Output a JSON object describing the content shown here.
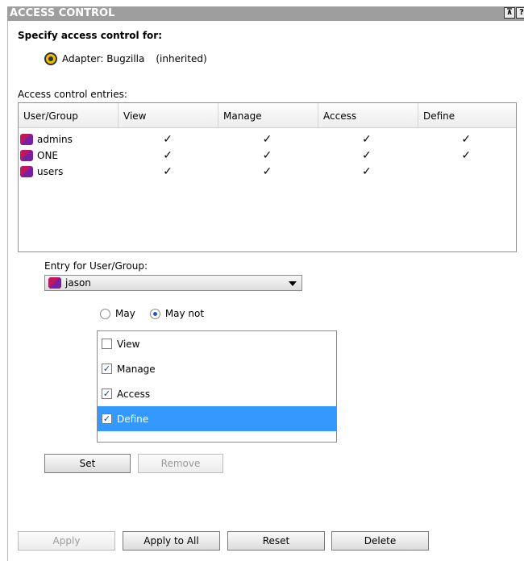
{
  "title": "ACCESS CONTROL",
  "title_buttons": [
    "⊼",
    "?"
  ],
  "heading": "Specify access control for:",
  "adapter": {
    "label": "Adapter: Bugzilla",
    "note": "(inherited)"
  },
  "entries_label": "Access control entries:",
  "columns": [
    "User/Group",
    "View",
    "Manage",
    "Access",
    "Define"
  ],
  "rows": [
    {
      "name": "admins",
      "view": "✓",
      "manage": "✓",
      "access": "✓",
      "define": "✓"
    },
    {
      "name": "ONE",
      "view": "✓",
      "manage": "✓",
      "access": "✓",
      "define": "✓"
    },
    {
      "name": "users",
      "view": "✓",
      "manage": "✓",
      "access": "✓",
      "define": ""
    }
  ],
  "entry_label": "Entry for User/Group:",
  "selected_user": "jason",
  "radio": {
    "may": "May",
    "may_not": "May not",
    "selected": "may_not"
  },
  "permissions": [
    {
      "label": "View",
      "checked": false
    },
    {
      "label": "Manage",
      "checked": true
    },
    {
      "label": "Access",
      "checked": true
    },
    {
      "label": "Define",
      "checked": true
    }
  ],
  "buttons": {
    "set": "Set",
    "remove": "Remove",
    "apply": "Apply",
    "apply_all": "Apply to All",
    "reset": "Reset",
    "delete": "Delete"
  }
}
